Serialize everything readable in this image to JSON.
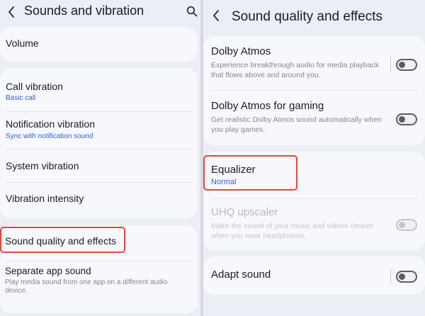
{
  "left_panel": {
    "title": "Sounds and vibration",
    "back_icon": "chevron-left-icon",
    "search_icon": "search-icon",
    "items": [
      {
        "label": "Volume"
      },
      {
        "label": "Call vibration",
        "sub": "Basic call"
      },
      {
        "label": "Notification vibration",
        "sub": "Sync with notification sound"
      },
      {
        "label": "System vibration"
      },
      {
        "label": "Vibration intensity"
      },
      {
        "label": "Sound quality and effects",
        "highlighted": true
      },
      {
        "label": "Separate app sound",
        "desc": "Play media sound from one app on a different audio device."
      }
    ]
  },
  "right_panel": {
    "title": "Sound quality and effects",
    "back_icon": "chevron-left-icon",
    "items": [
      {
        "label": "Dolby Atmos",
        "desc": "Experience breakthrough audio for media playback that flows above and around you.",
        "toggle": "off"
      },
      {
        "label": "Dolby Atmos for gaming",
        "desc": "Get realistic Dolby Atmos sound automatically when you play games.",
        "toggle": "off"
      },
      {
        "label": "Equalizer",
        "sub": "Normal",
        "highlighted": true
      },
      {
        "label": "UHQ upscaler",
        "desc": "Make the sound of your music and videos clearer when you wear headphones.",
        "toggle": "off",
        "disabled": true
      },
      {
        "label": "Adapt sound",
        "toggle": "off"
      }
    ]
  },
  "colors": {
    "highlight": "#e8463b",
    "accent_link": "#2f5fd0",
    "card_background": "#f7f8fc",
    "screen_background": "#eceef5"
  }
}
